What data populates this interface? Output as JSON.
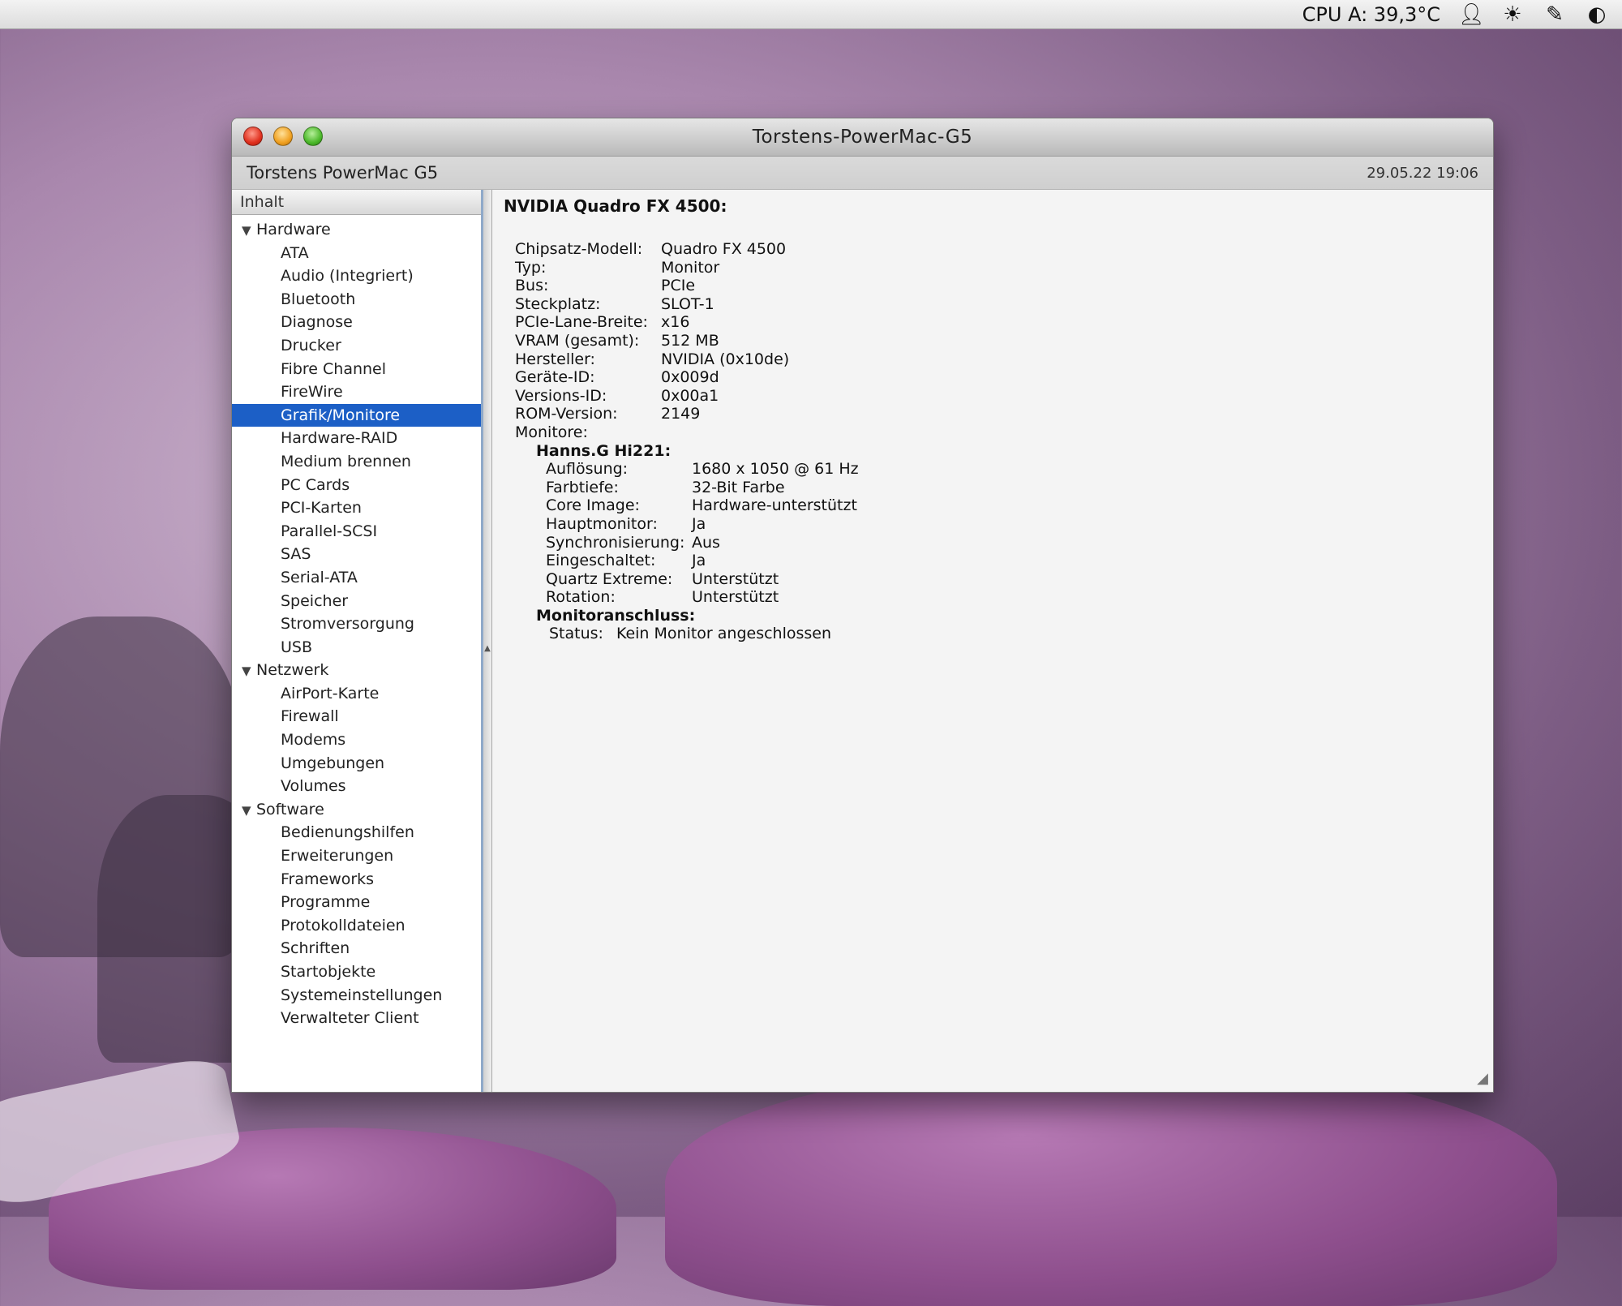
{
  "menubar": {
    "cpu_temp": "CPU A: 39,3°C",
    "icons": [
      "user-icon",
      "brightness-icon",
      "pen-icon",
      "status-icon"
    ]
  },
  "window": {
    "title": "Torstens-PowerMac-G5",
    "machine_name": "Torstens PowerMac G5",
    "timestamp": "29.05.22 19:06"
  },
  "sidebar": {
    "header": "Inhalt",
    "groups": [
      {
        "label": "Hardware",
        "items": [
          "ATA",
          "Audio (Integriert)",
          "Bluetooth",
          "Diagnose",
          "Drucker",
          "Fibre Channel",
          "FireWire",
          "Grafik/Monitore",
          "Hardware-RAID",
          "Medium brennen",
          "PC Cards",
          "PCI-Karten",
          "Parallel-SCSI",
          "SAS",
          "Serial-ATA",
          "Speicher",
          "Stromversorgung",
          "USB"
        ]
      },
      {
        "label": "Netzwerk",
        "items": [
          "AirPort-Karte",
          "Firewall",
          "Modems",
          "Umgebungen",
          "Volumes"
        ]
      },
      {
        "label": "Software",
        "items": [
          "Bedienungshilfen",
          "Erweiterungen",
          "Frameworks",
          "Programme",
          "Protokolldateien",
          "Schriften",
          "Startobjekte",
          "Systemeinstellungen",
          "Verwalteter Client"
        ]
      }
    ],
    "selected": "Grafik/Monitore"
  },
  "detail": {
    "title": "NVIDIA Quadro FX 4500:",
    "properties": [
      {
        "key": "Chipsatz-Modell:",
        "value": "Quadro FX 4500"
      },
      {
        "key": "Typ:",
        "value": "Monitor"
      },
      {
        "key": "Bus:",
        "value": "PCIe"
      },
      {
        "key": "Steckplatz:",
        "value": "SLOT-1"
      },
      {
        "key": "PCIe-Lane-Breite:",
        "value": "x16"
      },
      {
        "key": "VRAM (gesamt):",
        "value": "512 MB"
      },
      {
        "key": "Hersteller:",
        "value": "NVIDIA (0x10de)"
      },
      {
        "key": "Geräte-ID:",
        "value": "0x009d"
      },
      {
        "key": "Versions-ID:",
        "value": "0x00a1"
      },
      {
        "key": "ROM-Version:",
        "value": "2149"
      },
      {
        "key": "Monitore:",
        "value": ""
      }
    ],
    "monitor_name": "Hanns.G Hi221:",
    "monitor_properties": [
      {
        "key": "Auflösung:",
        "value": "1680 x 1050 @ 61 Hz"
      },
      {
        "key": "Farbtiefe:",
        "value": "32-Bit Farbe"
      },
      {
        "key": "Core Image:",
        "value": "Hardware-unterstützt"
      },
      {
        "key": "Hauptmonitor:",
        "value": "Ja"
      },
      {
        "key": "Synchronisierung:",
        "value": "Aus"
      },
      {
        "key": "Eingeschaltet:",
        "value": "Ja"
      },
      {
        "key": "Quartz Extreme:",
        "value": "Unterstützt"
      },
      {
        "key": "Rotation:",
        "value": "Unterstützt"
      }
    ],
    "connector_name": "Monitoranschluss:",
    "connector_status_key": "Status:",
    "connector_status_value": "Kein Monitor angeschlossen"
  }
}
